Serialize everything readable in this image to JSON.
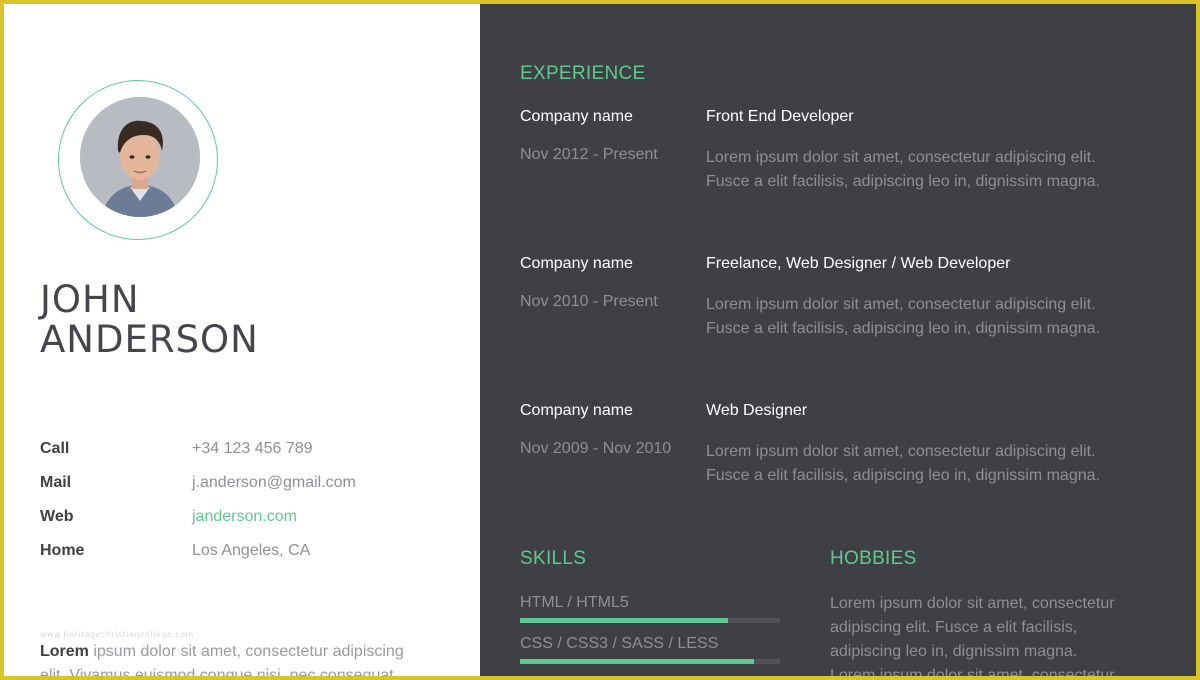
{
  "profile": {
    "first_name": "JOHN",
    "last_name": "ANDERSON",
    "avatar_icon": "person-photo"
  },
  "contacts": [
    {
      "label": "Call",
      "value": "+34 123 456 789"
    },
    {
      "label": "Mail",
      "value": "j.anderson@gmail.com"
    },
    {
      "label": "Web",
      "value": "janderson.com"
    },
    {
      "label": "Home",
      "value": "Los Angeles, CA"
    }
  ],
  "watermark": "www.heritagechristiancollege.com",
  "about": {
    "lead": "Lorem",
    "text": " ipsum dolor sit amet, consectetur adipiscing elit. Vivamus euismod congue nisi, nec consequat"
  },
  "experience": {
    "title": "EXPERIENCE",
    "items": [
      {
        "company": "Company name",
        "role": "Front End Developer",
        "dates": "Nov 2012 - Present",
        "desc_1": "Lorem ipsum dolor sit amet, consectetur adipiscing elit.",
        "desc_2": "Fusce a elit facilisis, adipiscing leo in, dignissim magna."
      },
      {
        "company": "Company name",
        "role": "Freelance, Web Designer / Web Developer",
        "dates": "Nov 2010 - Present",
        "desc_1": "Lorem ipsum dolor sit amet, consectetur adipiscing elit.",
        "desc_2": "Fusce a elit facilisis, adipiscing leo in, dignissim magna."
      },
      {
        "company": "Company name",
        "role": "Web Designer",
        "dates": "Nov 2009 - Nov 2010",
        "desc_1": "Lorem ipsum dolor sit amet, consectetur adipiscing elit.",
        "desc_2": "Fusce a elit facilisis, adipiscing leo in, dignissim magna."
      }
    ]
  },
  "skills": {
    "title": "SKILLS",
    "items": [
      {
        "label": "HTML / HTML5",
        "level": 0.8
      },
      {
        "label": "CSS / CSS3 / SASS / LESS",
        "level": 0.9
      }
    ]
  },
  "hobbies": {
    "title": "HOBBIES",
    "line_1": "Lorem ipsum dolor sit amet, consectetur",
    "line_2": "adipiscing elit. Fusce a elit facilisis,",
    "line_3": "adipiscing leo in, dignissim magna.",
    "line_4": "Lorem ipsum dolor sit amet, consectetur"
  },
  "colors": {
    "accent": "#5fc994",
    "dark_panel": "#3f4043",
    "frame": "#d9c42a"
  }
}
